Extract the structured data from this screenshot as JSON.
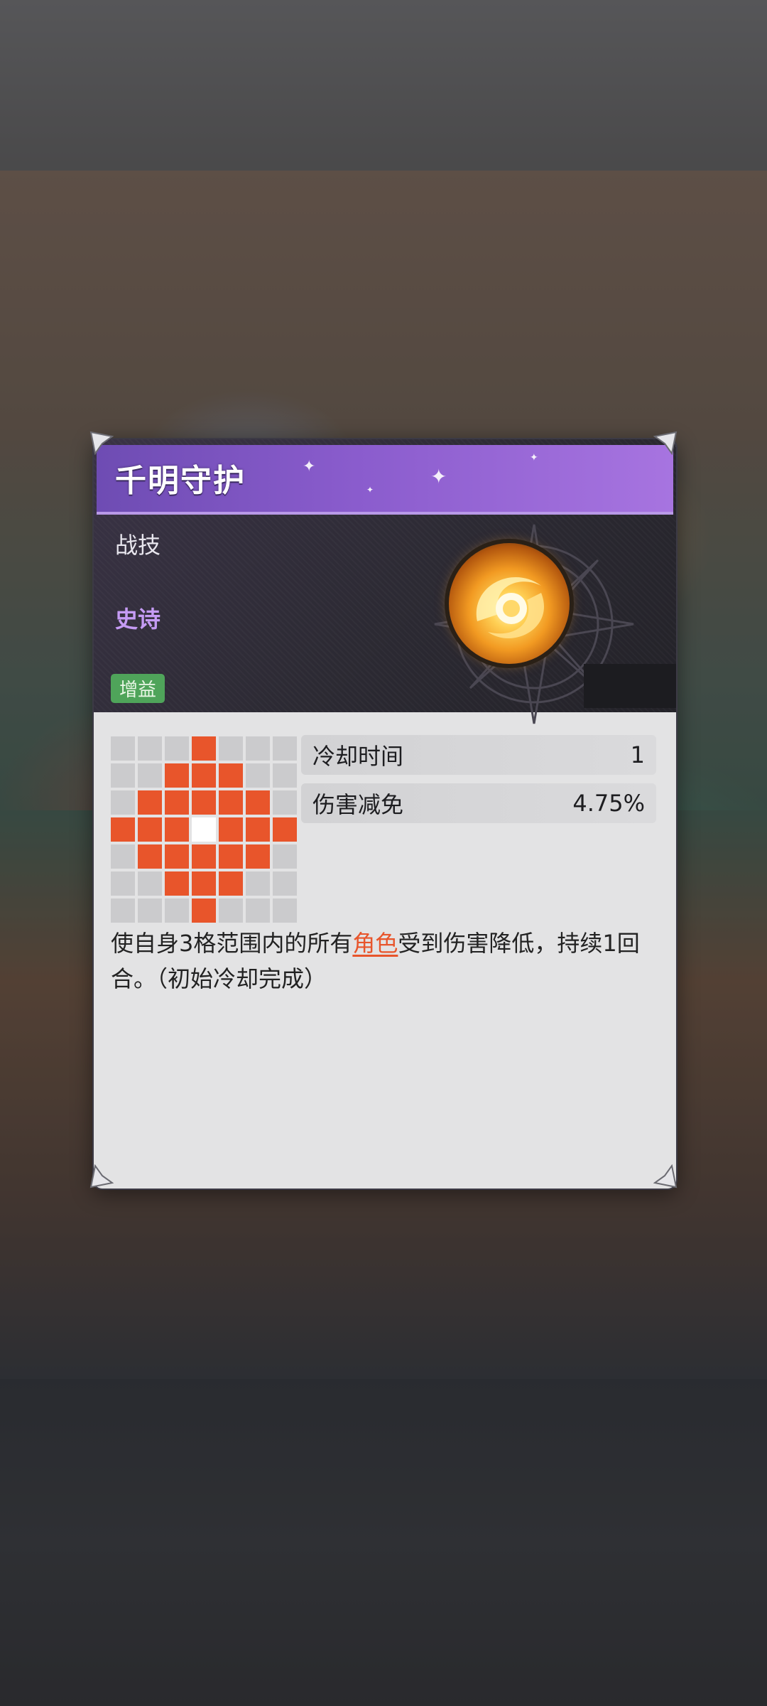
{
  "skill": {
    "name": "千明守护",
    "type": "战技",
    "rarity": "史诗",
    "tag": "增益",
    "icon": "flame-orb-icon"
  },
  "stats": [
    {
      "label": "冷却时间",
      "value": "1"
    },
    {
      "label": "伤害减免",
      "value": "4.75%"
    }
  ],
  "description": {
    "part1": "使自身3格范围内的所有",
    "highlight": "角色",
    "part2": "受到伤害降低，持续1回合。（初始冷却完成）"
  },
  "range_grid": {
    "columns": 7,
    "rows": 7,
    "pattern": [
      "...X...",
      "..XXX..",
      ".XXXXX.",
      "XXXSXXX",
      ".XXXXX.",
      "..XXX..",
      "...X..."
    ]
  },
  "colors": {
    "title_bar": "#8a5ccd",
    "rarity": "#c59bf4",
    "tag": "#4fa45a",
    "range_active": "#e8552b",
    "range_self": "#ffffff",
    "range_inactive": "#cbcbcd",
    "highlight": "#e8552b"
  }
}
